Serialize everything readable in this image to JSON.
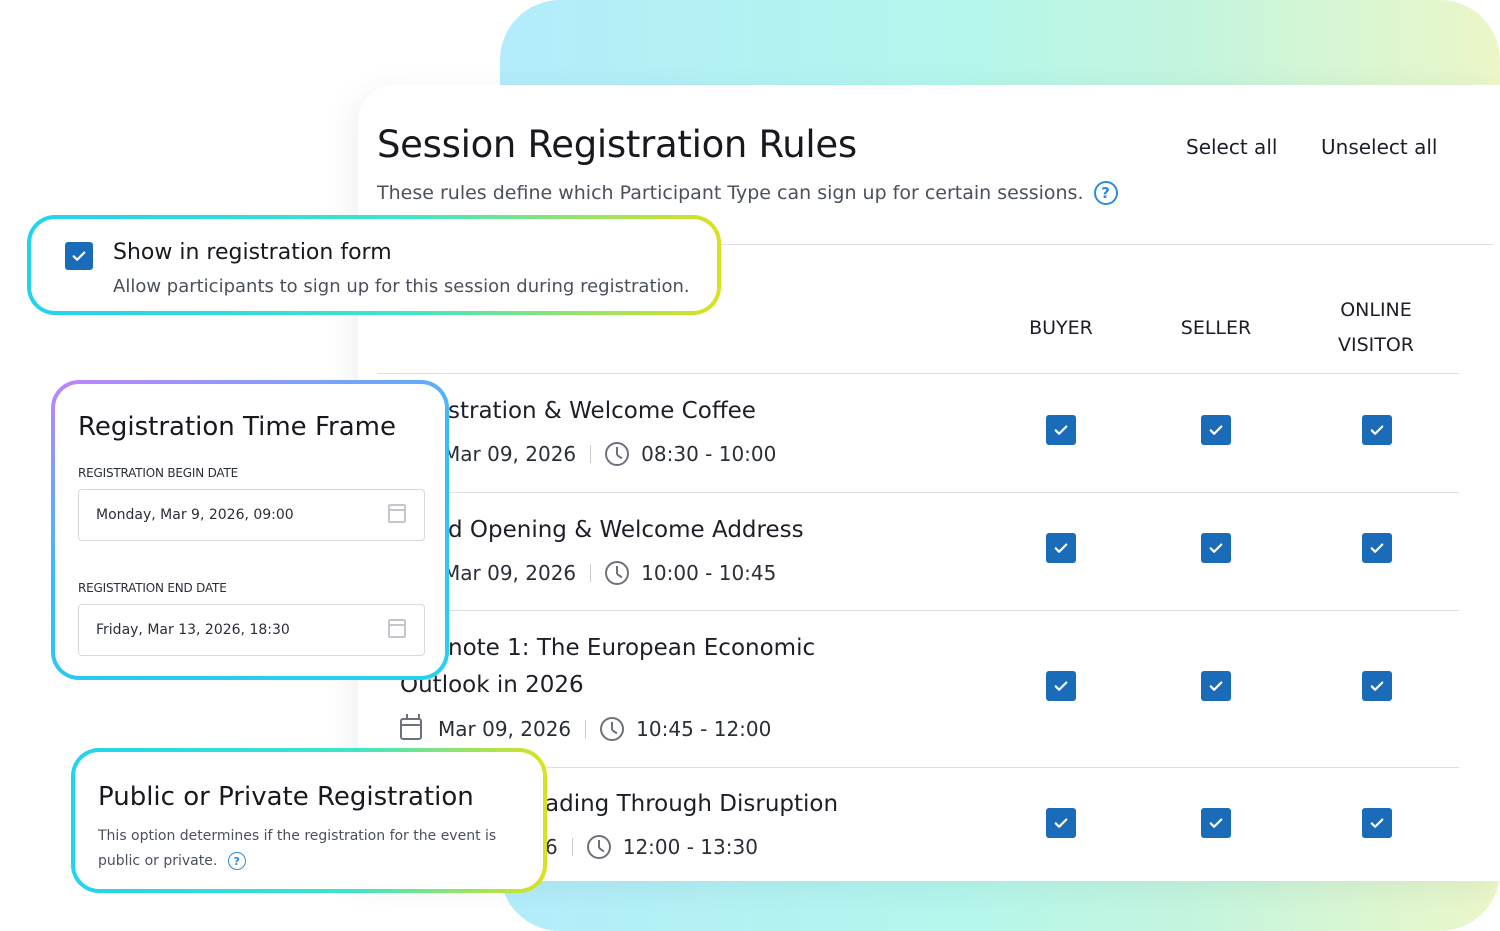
{
  "panel": {
    "title": "Session Registration Rules",
    "subtitle": "These rules define which Participant Type can sign up for certain sessions.",
    "select_all": "Select all",
    "unselect_all": "Unselect all"
  },
  "columns": {
    "buyer": "BUYER",
    "seller": "SELLER",
    "online_line1": "ONLINE",
    "online_line2": "VISITOR"
  },
  "sessions": [
    {
      "title": "stration & Welcome Coffee",
      "date": "Mar 09, 2026",
      "time": "08:30 - 10:00",
      "buyer": true,
      "seller": true,
      "online": true
    },
    {
      "title": "d Opening & Welcome Address",
      "date": "Mar 09, 2026",
      "time": "10:00 - 10:45",
      "buyer": true,
      "seller": true,
      "online": true
    },
    {
      "title_line1": "note 1: The European Economic",
      "title_line2": "Outlook in 2026",
      "date": "Mar 09, 2026",
      "time": "10:45 - 12:00",
      "buyer": true,
      "seller": true,
      "online": true
    },
    {
      "title": "ading Through Disruption",
      "date": "6",
      "time": "12:00 - 13:30",
      "buyer": true,
      "seller": true,
      "online": true
    }
  ],
  "show_form": {
    "checked": true,
    "title": "Show in registration form",
    "description": "Allow participants to sign up for this session during registration."
  },
  "time_frame": {
    "title": "Registration Time Frame",
    "begin_label": "REGISTRATION BEGIN DATE",
    "begin_value": "Monday, Mar 9, 2026, 09:00",
    "end_label": "REGISTRATION END DATE",
    "end_value": "Friday, Mar 13, 2026, 18:30"
  },
  "public_private": {
    "title": "Public or Private Registration",
    "description": "This option determines if the registration for the event is public or private."
  },
  "colors": {
    "accent": "#1a6bb8",
    "help": "#2f8be0"
  }
}
